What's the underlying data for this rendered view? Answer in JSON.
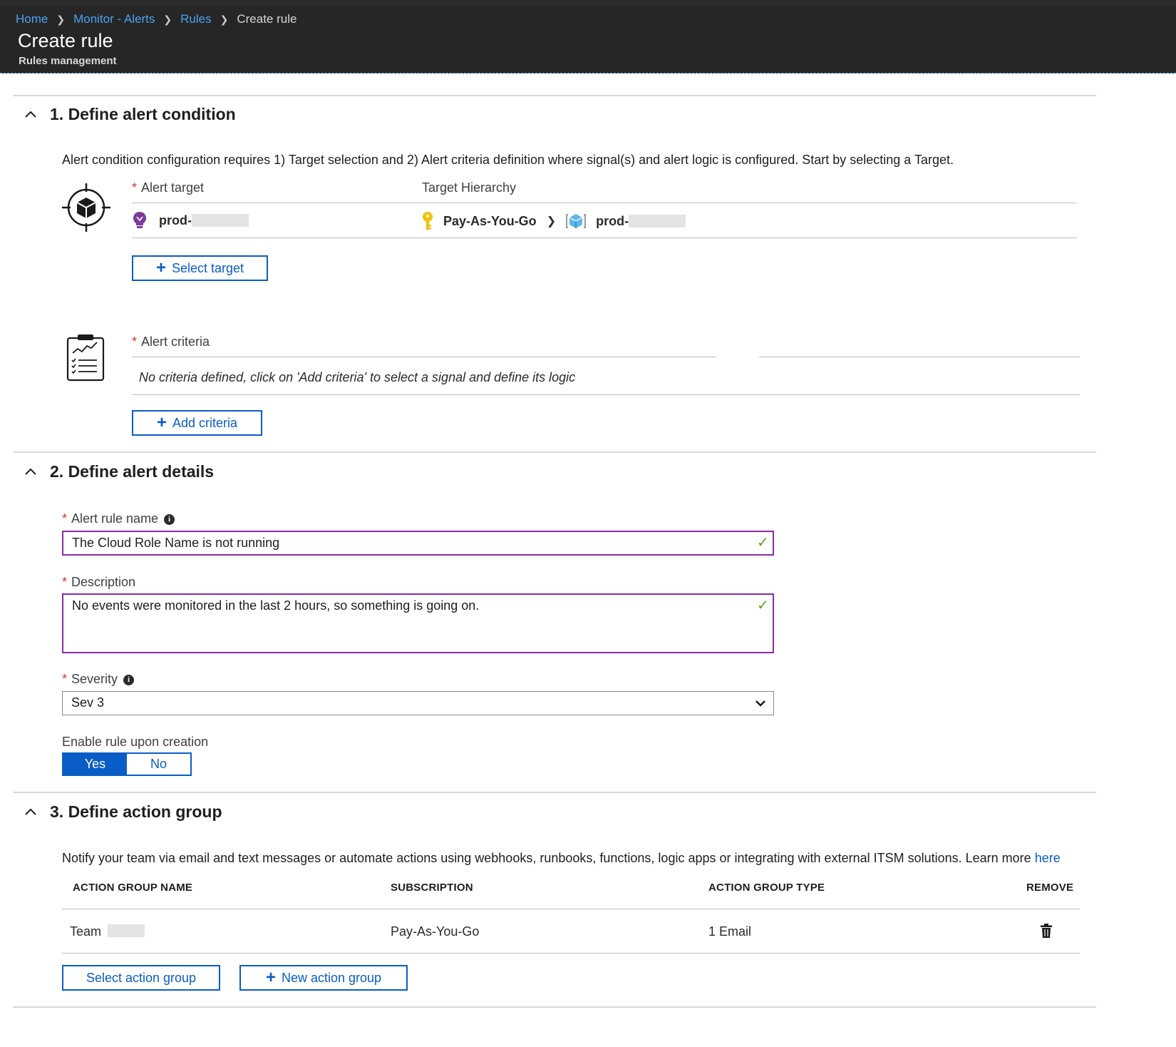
{
  "breadcrumb": {
    "home": "Home",
    "monitor": "Monitor - Alerts",
    "rules": "Rules",
    "current": "Create rule"
  },
  "header": {
    "title": "Create rule",
    "subtitle": "Rules management"
  },
  "section1": {
    "title": "1. Define alert condition",
    "description": "Alert condition configuration requires 1) Target selection and 2) Alert criteria definition where signal(s) and alert logic is configured. Start by selecting a Target.",
    "alert_target_label": "Alert target",
    "target_hierarchy_label": "Target Hierarchy",
    "target_name": "prod-",
    "hierarchy_subscription": "Pay-As-You-Go",
    "hierarchy_resource": "prod-",
    "select_target_button": "Select target",
    "alert_criteria_label": "Alert criteria",
    "criteria_empty": "No criteria defined, click on 'Add criteria' to select a signal and define its logic",
    "add_criteria_button": "Add criteria"
  },
  "section2": {
    "title": "2. Define alert details",
    "rule_name_label": "Alert rule name",
    "rule_name_value": "The Cloud Role Name is not running",
    "description_label": "Description",
    "description_value": "No events were monitored in the last 2 hours, so something is going on.",
    "severity_label": "Severity",
    "severity_value": "Sev 3",
    "enable_label": "Enable rule upon creation",
    "yes_label": "Yes",
    "no_label": "No",
    "enable_selected": "Yes"
  },
  "section3": {
    "title": "3. Define action group",
    "description": "Notify your team via email and text messages or automate actions using webhooks, runbooks, functions, logic apps or integrating with external ITSM solutions. Learn more ",
    "learn_more_link": "here",
    "columns": [
      "ACTION GROUP NAME",
      "SUBSCRIPTION",
      "ACTION GROUP TYPE",
      "REMOVE"
    ],
    "rows": [
      {
        "name": "Team",
        "subscription": "Pay-As-You-Go",
        "type": "1 Email"
      }
    ],
    "select_button": "Select action group",
    "new_button": "New action group"
  },
  "icons": {
    "chevron": "chevron-up-icon",
    "target": "target-cube-icon",
    "criteria": "clipboard-chart-icon",
    "app_insights": "lightbulb-icon",
    "subscription": "key-icon",
    "resource_group": "cube-icon",
    "remove": "trash-icon",
    "check": "checkmark-icon",
    "info": "info-icon"
  },
  "colors": {
    "accent": "#0a5dc7",
    "header_bg": "#262626",
    "valid_field_border": "#8a2aa8",
    "check": "#5aa515",
    "required": "#d33333"
  }
}
